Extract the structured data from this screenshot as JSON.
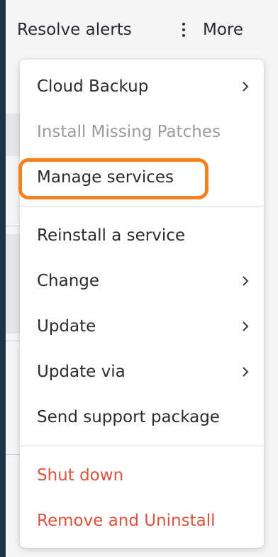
{
  "topbar": {
    "resolve_label": "Resolve alerts",
    "more_label": "More"
  },
  "menu": {
    "items": [
      {
        "label": "Cloud Backup",
        "has_submenu": true,
        "state": "enabled"
      },
      {
        "label": "Install Missing Patches",
        "has_submenu": false,
        "state": "disabled"
      },
      {
        "label": "Manage services",
        "has_submenu": false,
        "state": "highlighted"
      },
      {
        "label": "Reinstall a service",
        "has_submenu": false,
        "state": "enabled"
      },
      {
        "label": "Change",
        "has_submenu": true,
        "state": "enabled"
      },
      {
        "label": "Update",
        "has_submenu": true,
        "state": "enabled"
      },
      {
        "label": "Update via",
        "has_submenu": true,
        "state": "enabled"
      },
      {
        "label": "Send support package",
        "has_submenu": false,
        "state": "enabled"
      },
      {
        "label": "Shut down",
        "has_submenu": false,
        "state": "danger"
      },
      {
        "label": "Remove and Uninstall",
        "has_submenu": false,
        "state": "danger"
      }
    ]
  },
  "colors": {
    "highlight_ring": "#f5821f",
    "danger_text": "#d9533f",
    "disabled_text": "#9a9aa0",
    "left_rail": "#1d3448"
  },
  "icons": {
    "submenu": "chevron-right-icon",
    "more": "kebab-menu-icon"
  }
}
